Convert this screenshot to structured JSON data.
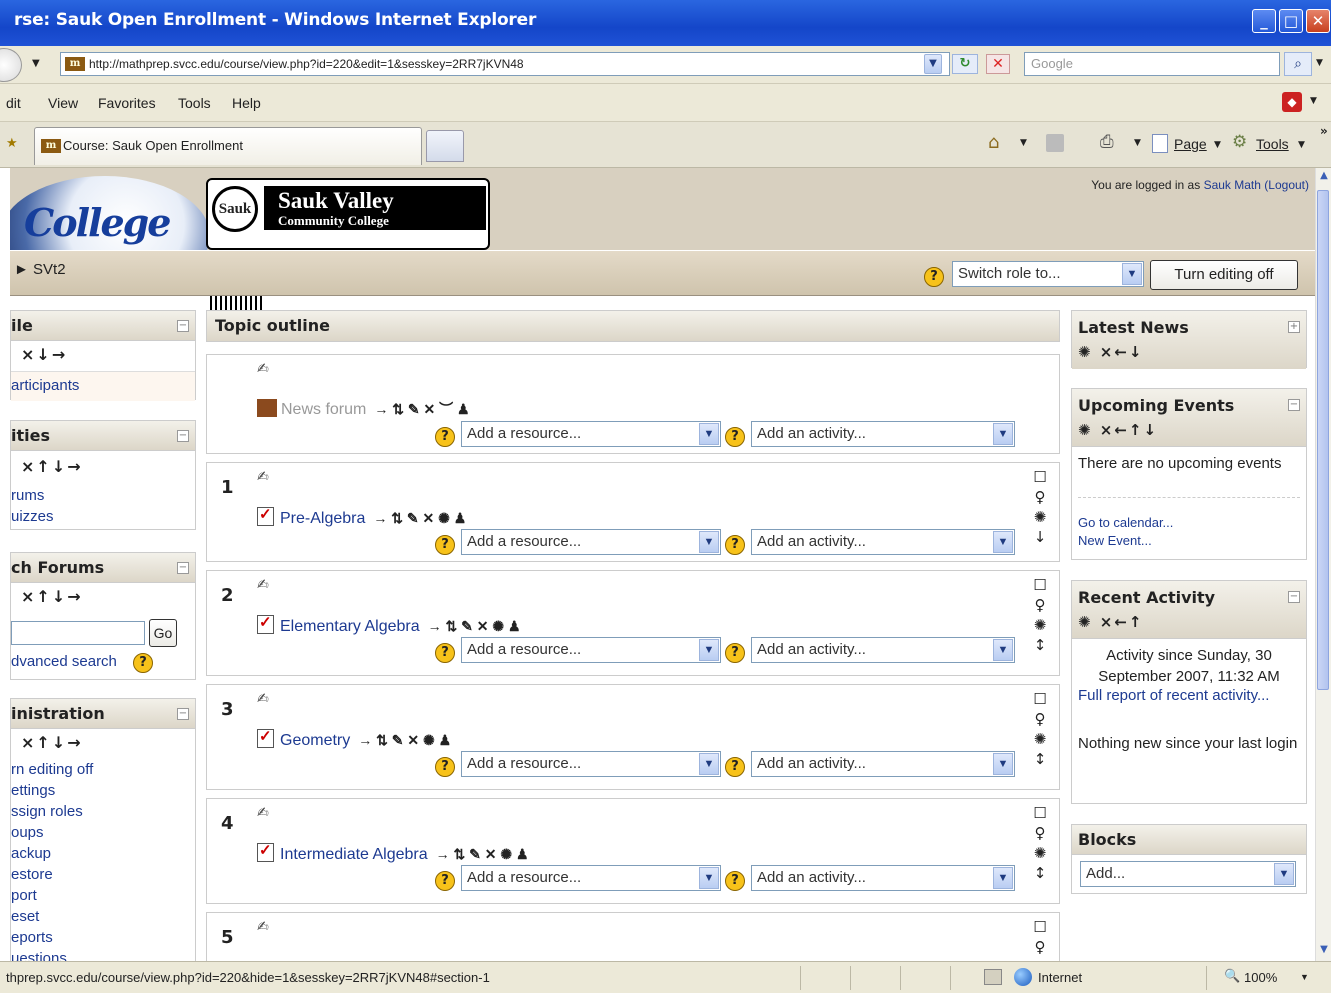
{
  "window": {
    "title": "rse: Sauk Open Enrollment - Windows Internet Explorer",
    "minimize": "_",
    "maximize": "□",
    "close": "✕"
  },
  "address": {
    "url": "http://mathprep.svcc.edu/course/view.php?id=220&edit=1&sesskey=2RR7jKVN48",
    "search_placeholder": "Google"
  },
  "menu": [
    "dit",
    "View",
    "Favorites",
    "Tools",
    "Help"
  ],
  "tabs": {
    "active_label": "Course: Sauk Open Enrollment",
    "page_label": "Page",
    "tools_label": "Tools"
  },
  "header": {
    "logo1_text": "College",
    "logo2_badge": "Sauk",
    "logo2_title": "Sauk Valley",
    "logo2_subtitle": "Community College",
    "logged_in_prefix": "You are logged in as",
    "user_name": "Sauk Math",
    "logout": "(Logout)"
  },
  "navbar": {
    "breadcrumb": "► SVt2",
    "switch_role": "Switch role to...",
    "turn_editing_off": "Turn editing off"
  },
  "left_blocks": {
    "people": {
      "title": "ile",
      "controls": "×↓→",
      "links": [
        "articipants"
      ]
    },
    "activities": {
      "title": "ities",
      "controls": "×↑↓→",
      "links": [
        "rums",
        "uizzes"
      ]
    },
    "search": {
      "title": "ch Forums",
      "controls": "×↑↓→",
      "go": "Go",
      "advanced": "dvanced search"
    },
    "admin": {
      "title": "inistration",
      "controls": "×↑↓→",
      "links": [
        "rn editing off",
        "ettings",
        "ssign roles",
        "oups",
        "ackup",
        "estore",
        "port",
        "eset",
        "eports",
        "uestions"
      ]
    }
  },
  "main": {
    "topic_outline": "Topic outline",
    "add_resource": "Add a resource...",
    "add_activity": "Add an activity...",
    "section0": {
      "activity": "News forum",
      "tools": "→ ⇅ ✎ ✕ ︶ ♟"
    },
    "sections": [
      {
        "num": "1",
        "activity": "Pre-Algebra",
        "tools": "→ ⇅ ✎ ✕ ✺ ♟"
      },
      {
        "num": "2",
        "activity": "Elementary Algebra",
        "tools": "→ ⇅ ✎ ✕ ✺ ♟"
      },
      {
        "num": "3",
        "activity": "Geometry",
        "tools": "→ ⇅ ✎ ✕ ✺ ♟"
      },
      {
        "num": "4",
        "activity": "Intermediate Algebra",
        "tools": "→ ⇅ ✎ ✕ ✺ ♟"
      },
      {
        "num": "5"
      }
    ]
  },
  "right_blocks": {
    "latest_news": {
      "title": "Latest News",
      "controls": "✺ ×←↓"
    },
    "upcoming": {
      "title": "Upcoming Events",
      "controls": "✺ ×←↑↓",
      "body": "There are no upcoming events",
      "links": [
        "Go to calendar...",
        "New Event..."
      ]
    },
    "recent": {
      "title": "Recent Activity",
      "controls": "✺ ×←↑",
      "since": "Activity since Sunday, 30 September 2007, 11:32 AM",
      "full_report": "Full report of recent activity...",
      "nothing_new": "Nothing new since your last login"
    },
    "blocks": {
      "title": "Blocks",
      "add": "Add..."
    }
  },
  "status": {
    "url": "thprep.svcc.edu/course/view.php?id=220&hide=1&sesskey=2RR7jKVN48#section-1",
    "zone": "Internet",
    "zoom": "100%"
  }
}
